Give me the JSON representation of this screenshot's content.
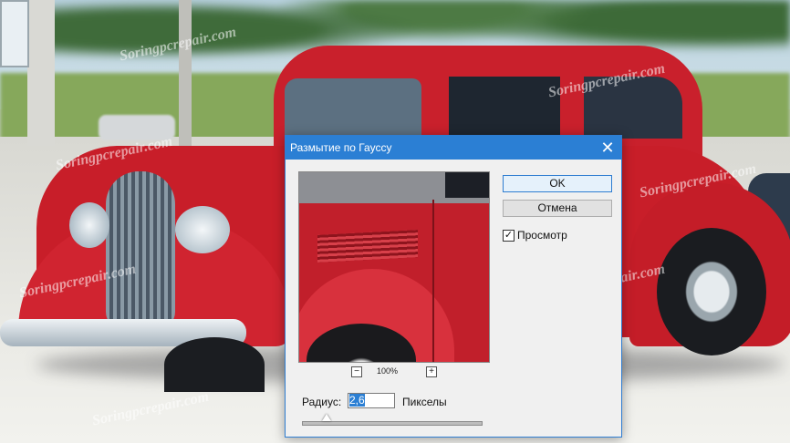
{
  "watermark": "Soringpcrepair.com",
  "dialog": {
    "title": "Размытие по Гауссу",
    "close_glyph": "✕",
    "ok_label": "OK",
    "cancel_label": "Отмена",
    "preview_label": "Просмотр",
    "preview_checked": true,
    "zoom_level": "100%",
    "zoom_out_glyph": "−",
    "zoom_in_glyph": "+",
    "radius_label": "Радиус:",
    "radius_value": "2,6",
    "radius_unit": "Пикселы",
    "radius_slider_fraction": 0.14
  },
  "colors": {
    "titlebar": "#2b7fd4",
    "car": "#c81e29"
  }
}
